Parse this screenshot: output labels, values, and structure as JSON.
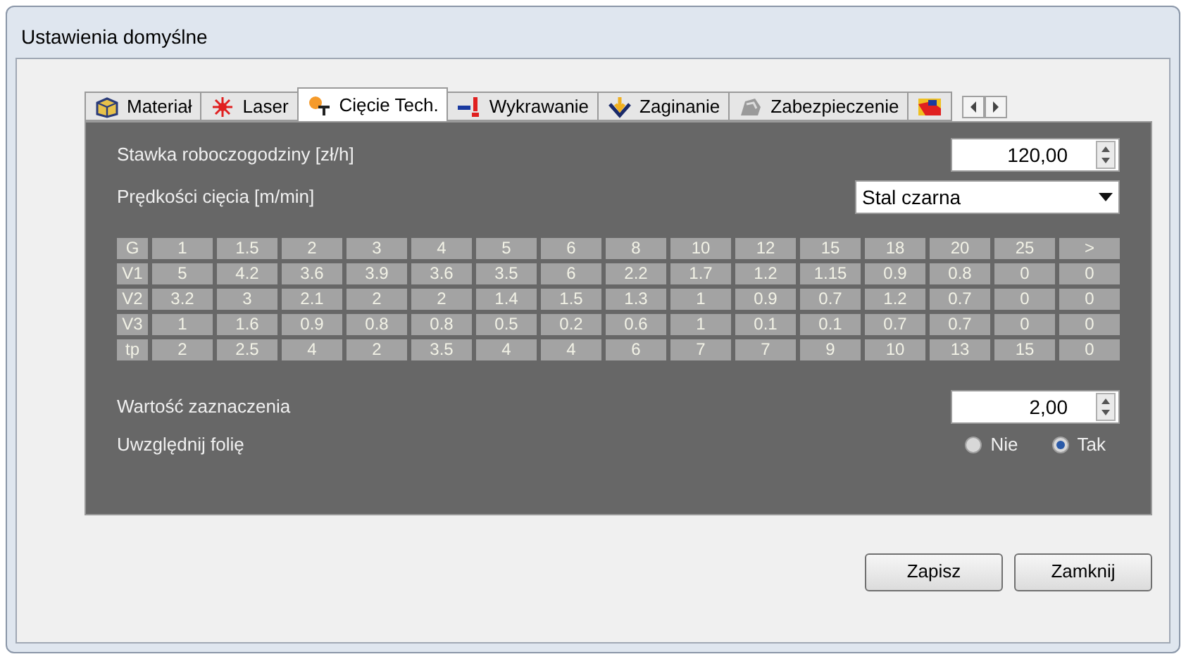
{
  "window": {
    "title": "Ustawienia domyślne"
  },
  "tabs": [
    {
      "label": "Materiał",
      "selected": false,
      "kind": "text"
    },
    {
      "label": "Laser",
      "selected": false,
      "kind": "text"
    },
    {
      "label": "Cięcie Tech.",
      "selected": true,
      "kind": "text"
    },
    {
      "label": "Wykrawanie",
      "selected": false,
      "kind": "text"
    },
    {
      "label": "Zaginanie",
      "selected": false,
      "kind": "text"
    },
    {
      "label": "Zabezpieczenie",
      "selected": false,
      "kind": "text"
    },
    {
      "selected": false,
      "kind": "icon-only"
    }
  ],
  "rate": {
    "label": "Stawka roboczogodziny [zł/h]",
    "value": "120,00"
  },
  "speeds": {
    "label": "Prędkości cięcia [m/min]",
    "value": "Stal czarna"
  },
  "table": {
    "rows": [
      [
        "G",
        "1",
        "1.5",
        "2",
        "3",
        "4",
        "5",
        "6",
        "8",
        "10",
        "12",
        "15",
        "18",
        "20",
        "25",
        ">"
      ],
      [
        "V1",
        "5",
        "4.2",
        "3.6",
        "3.9",
        "3.6",
        "3.5",
        "6",
        "2.2",
        "1.7",
        "1.2",
        "1.15",
        "0.9",
        "0.8",
        "0",
        "0"
      ],
      [
        "V2",
        "3.2",
        "3",
        "2.1",
        "2",
        "2",
        "1.4",
        "1.5",
        "1.3",
        "1",
        "0.9",
        "0.7",
        "1.2",
        "0.7",
        "0",
        "0"
      ],
      [
        "V3",
        "1",
        "1.6",
        "0.9",
        "0.8",
        "0.8",
        "0.5",
        "0.2",
        "0.6",
        "1",
        "0.1",
        "0.1",
        "0.7",
        "0.7",
        "0",
        "0"
      ],
      [
        "tp",
        "2",
        "2.5",
        "4",
        "2",
        "3.5",
        "4",
        "4",
        "6",
        "7",
        "7",
        "9",
        "10",
        "13",
        "15",
        "0"
      ]
    ]
  },
  "marker": {
    "label": "Wartość zaznaczenia",
    "value": "2,00"
  },
  "foil": {
    "label": "Uwzględnij folię",
    "options": [
      {
        "label": "Nie",
        "selected": false
      },
      {
        "label": "Tak",
        "selected": true
      }
    ]
  },
  "buttons": [
    "Zapisz",
    "Zamknij"
  ]
}
